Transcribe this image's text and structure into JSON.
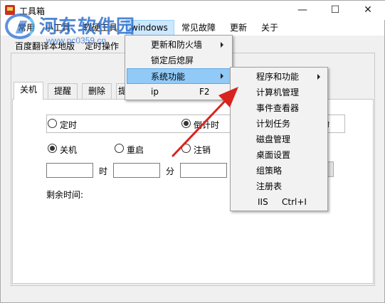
{
  "window": {
    "title": "工具箱",
    "controls": {
      "minimize": "—",
      "maximize": "☐",
      "close": "✕"
    }
  },
  "watermark": {
    "name": "河东软件园",
    "url": "www.pc0359.cn"
  },
  "menubar": {
    "items": [
      {
        "label": "常用"
      },
      {
        "label": "小工具"
      },
      {
        "label": "软硬工具"
      },
      {
        "label": "windows"
      },
      {
        "label": "常见故障"
      },
      {
        "label": "更新"
      },
      {
        "label": "关于"
      }
    ]
  },
  "toolbar": {
    "tabs": [
      {
        "label": "百度翻译本地版"
      },
      {
        "label": "定时操作"
      }
    ]
  },
  "tabs": [
    {
      "label": "关机"
    },
    {
      "label": "提醒"
    },
    {
      "label": "删除"
    },
    {
      "label": "提"
    }
  ],
  "form": {
    "mode_options": [
      {
        "label": "定时",
        "checked": false
      },
      {
        "label": "倒计时",
        "checked": true
      }
    ],
    "action_options": [
      {
        "label": "关机",
        "checked": true
      },
      {
        "label": "重启",
        "checked": false
      },
      {
        "label": "注销",
        "checked": false
      }
    ],
    "time_fields": [
      {
        "value": "",
        "unit": "时"
      },
      {
        "value": "",
        "unit": "分"
      },
      {
        "value": "",
        "unit": ""
      }
    ],
    "remaining_label": "剩余时间:",
    "group_right_fragment": "时"
  },
  "windows_menu": {
    "items": [
      {
        "label": "更新和防火墙",
        "submenu": true
      },
      {
        "label": "锁定后熄屏",
        "submenu": false
      },
      {
        "label": "系统功能",
        "submenu": true,
        "highlighted": true
      },
      {
        "label": "ip",
        "shortcut": "F2"
      }
    ]
  },
  "system_menu": {
    "items": [
      {
        "label": "程序和功能",
        "submenu": true
      },
      {
        "label": "计算机管理"
      },
      {
        "label": "事件查看器"
      },
      {
        "label": "计划任务"
      },
      {
        "label": "磁盘管理"
      },
      {
        "label": "桌面设置"
      },
      {
        "label": "组策略"
      },
      {
        "label": "注册表"
      },
      {
        "label": "IIS",
        "shortcut": "Ctrl+I"
      }
    ]
  },
  "colors": {
    "highlight": "#91c9f7",
    "menu_selected": "#cce8ff",
    "arrow": "#d8231f",
    "watermark": "#1e64c8"
  }
}
